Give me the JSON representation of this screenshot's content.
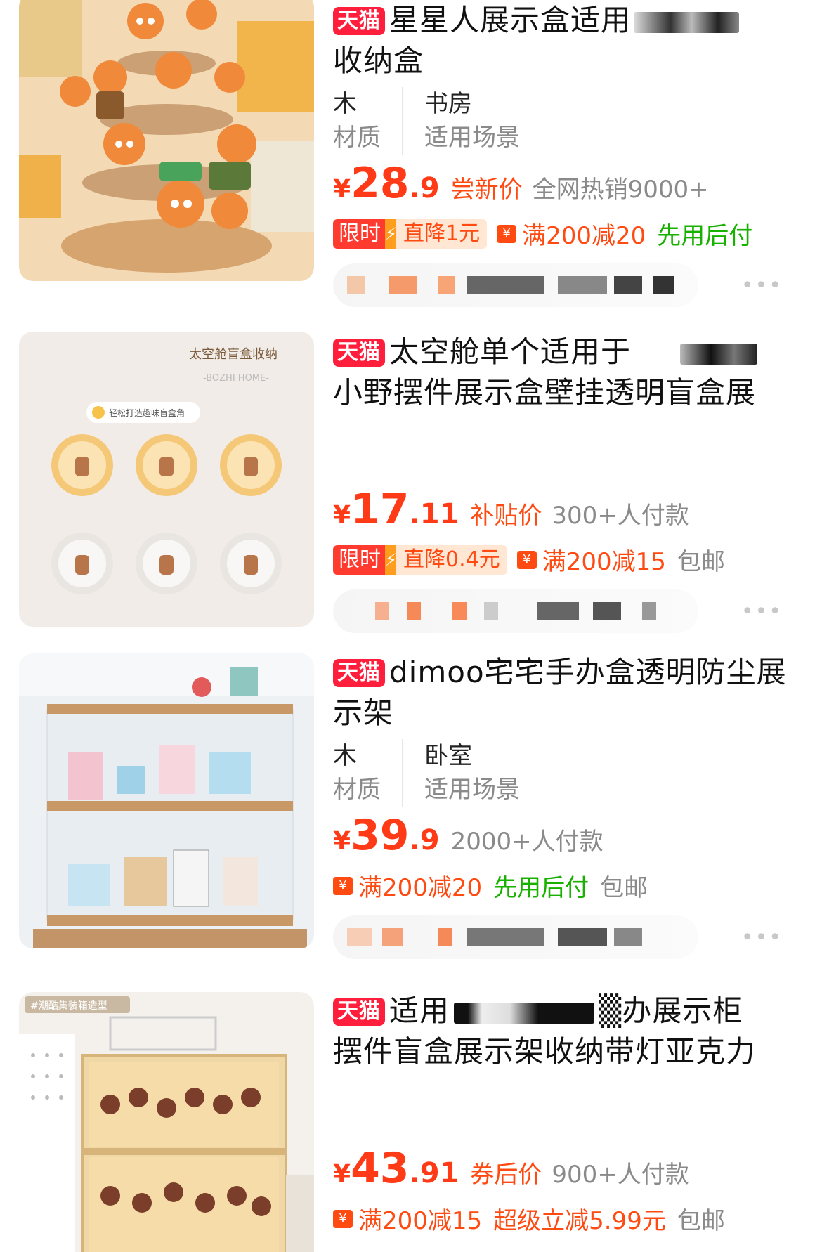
{
  "products": [
    {
      "badge": "天猫",
      "title_line1": "星星人展示盒适用",
      "title_line2": "收纳盒",
      "attrs": [
        {
          "value": "木",
          "key": "材质"
        },
        {
          "value": "书房",
          "key": "适用场景"
        }
      ],
      "price_yen": "¥",
      "price_int": "28",
      "price_dec": ".9",
      "price_tag": "尝新价",
      "sales": "全网热销9000+",
      "limit_label": "限时",
      "limit_discount": "直降1元",
      "coupon": "满200减20",
      "pay_later": "先用后付",
      "free_shipping": "",
      "more": "•••"
    },
    {
      "badge": "天猫",
      "title_line1": "太空舱单个适用于",
      "title_line2": "小野摆件展示盒壁挂透明盲盒展",
      "attrs": [],
      "price_yen": "¥",
      "price_int": "17",
      "price_dec": ".11",
      "price_tag": "补贴价",
      "sales": "300+人付款",
      "limit_label": "限时",
      "limit_discount": "直降0.4元",
      "coupon": "满200减15",
      "pay_later": "",
      "free_shipping": "包邮",
      "more": "•••",
      "image_text_title": "太空舱盲盒收纳",
      "image_text_brand": "-BOZHI HOME-",
      "image_text_bubble": "轻松打造趣味盲盒角"
    },
    {
      "badge": "天猫",
      "title_line1": "dimoo宅宅手办盒透明防尘展",
      "title_line2": "示架",
      "attrs": [
        {
          "value": "木",
          "key": "材质"
        },
        {
          "value": "卧室",
          "key": "适用场景"
        }
      ],
      "price_yen": "¥",
      "price_int": "39",
      "price_dec": ".9",
      "price_tag": "",
      "sales": "2000+人付款",
      "limit_label": "",
      "limit_discount": "",
      "coupon": "满200减20",
      "pay_later": "先用后付",
      "free_shipping": "包邮",
      "more": "•••"
    },
    {
      "badge": "天猫",
      "title_line1": "适用",
      "title_line1_tail": "▒办展示柜",
      "title_line2": "摆件盲盒展示架收纳带灯亚克力",
      "attrs": [],
      "price_yen": "¥",
      "price_int": "43",
      "price_dec": ".91",
      "price_tag": "券后价",
      "sales": "900+人付款",
      "limit_label": "",
      "limit_discount": "",
      "coupon": "满200减15",
      "pay_later": "",
      "super_discount": "超级立减5.99元",
      "free_shipping": "包邮",
      "more": "",
      "image_text_tag": "#潮酷集装箱造型"
    }
  ],
  "icons": {
    "tmall": "tmall-badge",
    "coupon": "coupon-icon",
    "bolt": "lightning-icon",
    "more": "more-dots-icon"
  },
  "colors": {
    "price": "#ff3b17",
    "tmall": "#ff1f3d",
    "green": "#18b100",
    "muted": "#8a8a8a"
  }
}
